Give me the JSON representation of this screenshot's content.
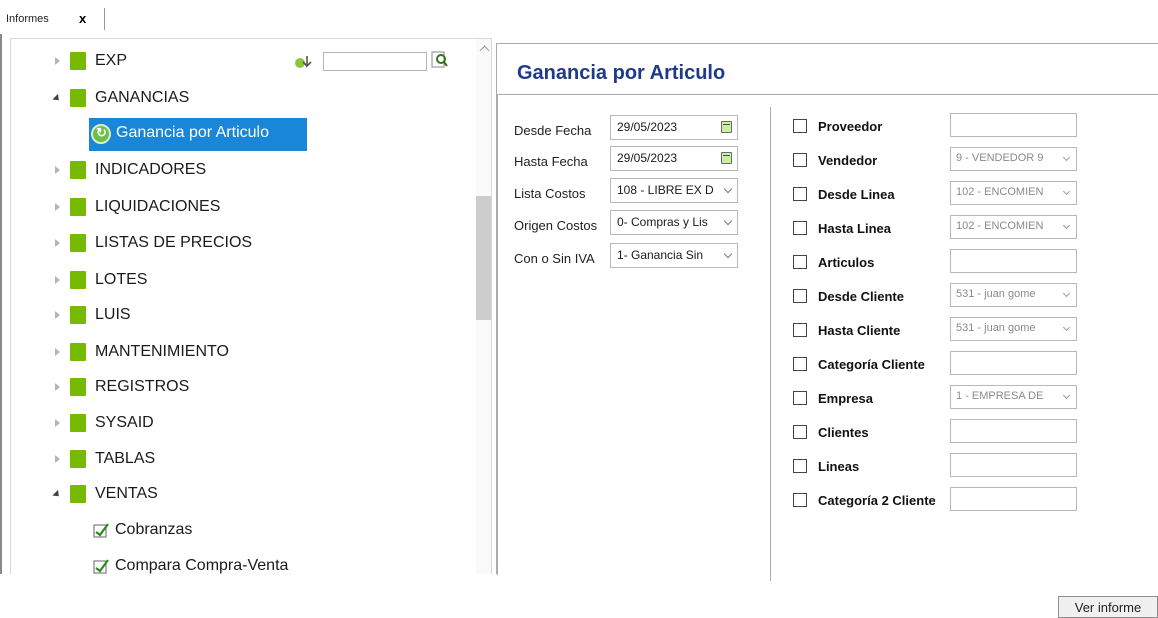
{
  "tabs": [
    {
      "label": "Informes",
      "close": "x"
    }
  ],
  "tree": {
    "search": {
      "value": ""
    },
    "items": [
      {
        "label": "EXP",
        "type": "folder",
        "state": "closed"
      },
      {
        "label": "GANANCIAS",
        "type": "folder",
        "state": "open"
      },
      {
        "label": "Ganancia por Articulo",
        "type": "report",
        "selected": true
      },
      {
        "label": "INDICADORES",
        "type": "folder",
        "state": "closed"
      },
      {
        "label": "LIQUIDACIONES",
        "type": "folder",
        "state": "closed"
      },
      {
        "label": "LISTAS DE PRECIOS",
        "type": "folder",
        "state": "closed"
      },
      {
        "label": "LOTES",
        "type": "folder",
        "state": "closed"
      },
      {
        "label": "LUIS",
        "type": "folder",
        "state": "closed"
      },
      {
        "label": "MANTENIMIENTO",
        "type": "folder",
        "state": "closed"
      },
      {
        "label": "REGISTROS",
        "type": "folder",
        "state": "closed"
      },
      {
        "label": "SYSAID",
        "type": "folder",
        "state": "closed"
      },
      {
        "label": "TABLAS",
        "type": "folder",
        "state": "closed"
      },
      {
        "label": "VENTAS",
        "type": "folder",
        "state": "open"
      },
      {
        "label": "Cobranzas",
        "type": "report"
      },
      {
        "label": "Compara Compra-Venta",
        "type": "report"
      }
    ]
  },
  "report": {
    "title": "Ganancia por Articulo",
    "fields": [
      {
        "label": "Desde Fecha",
        "value": "29/05/2023",
        "kind": "date"
      },
      {
        "label": "Hasta Fecha",
        "value": "29/05/2023",
        "kind": "date"
      },
      {
        "label": "Lista Costos",
        "value": "108 - LIBRE EX D",
        "kind": "select"
      },
      {
        "label": "Origen Costos",
        "value": "0- Compras y Lis",
        "kind": "select"
      },
      {
        "label": "Con o Sin IVA",
        "value": "1- Ganancia Sin",
        "kind": "select"
      }
    ],
    "filters": [
      {
        "label": "Proveedor",
        "value": ""
      },
      {
        "label": "Vendedor",
        "value": "9 - VENDEDOR 9"
      },
      {
        "label": "Desde Linea",
        "value": "102 - ENCOMIEN"
      },
      {
        "label": "Hasta Linea",
        "value": "102 - ENCOMIEN"
      },
      {
        "label": "Articulos",
        "value": ""
      },
      {
        "label": "Desde Cliente",
        "value": "531 - juan gome"
      },
      {
        "label": "Hasta Cliente",
        "value": "531 - juan gome"
      },
      {
        "label": "Categoría Cliente",
        "value": ""
      },
      {
        "label": "Empresa",
        "value": "1 - EMPRESA DE"
      },
      {
        "label": "Clientes",
        "value": ""
      },
      {
        "label": "Lineas",
        "value": ""
      },
      {
        "label": "Categoría 2 Cliente",
        "value": ""
      }
    ],
    "button": "Ver informe"
  },
  "colors": {
    "accent": "#1a86d9",
    "folder": "#77b900",
    "title": "#1f3a8a"
  }
}
